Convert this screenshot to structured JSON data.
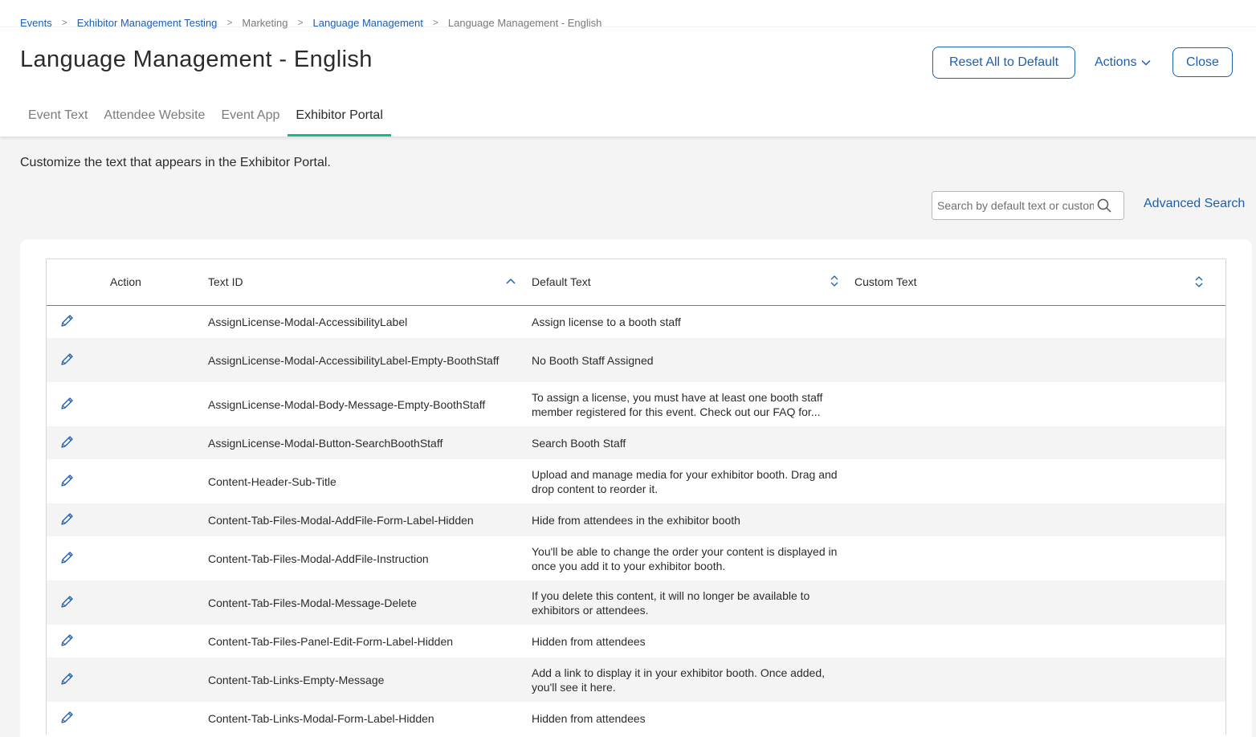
{
  "breadcrumb": [
    {
      "label": "Events",
      "link": true
    },
    {
      "label": "Exhibitor Management Testing",
      "link": true
    },
    {
      "label": "Marketing",
      "link": false
    },
    {
      "label": "Language Management",
      "link": true
    },
    {
      "label": "Language Management - English",
      "link": false
    }
  ],
  "page": {
    "title": "Language Management - English"
  },
  "buttons": {
    "reset": "Reset All to Default",
    "actions": "Actions",
    "close": "Close"
  },
  "tabs": [
    {
      "label": "Event Text",
      "active": false
    },
    {
      "label": "Attendee Website",
      "active": false
    },
    {
      "label": "Event App",
      "active": false
    },
    {
      "label": "Exhibitor Portal",
      "active": true
    }
  ],
  "description": "Customize the text that appears in the Exhibitor Portal.",
  "search": {
    "placeholder": "Search by default text or custom text",
    "advanced": "Advanced Search"
  },
  "table": {
    "columns": {
      "action": "Action",
      "text_id": "Text ID",
      "default_text": "Default Text",
      "custom_text": "Custom Text"
    },
    "rows": [
      {
        "text_id": "AssignLicense-Modal-AccessibilityLabel",
        "default_text": "Assign license to a booth staff",
        "custom_text": ""
      },
      {
        "text_id": "AssignLicense-Modal-AccessibilityLabel-Empty-BoothStaff",
        "default_text": "No Booth Staff Assigned",
        "custom_text": ""
      },
      {
        "text_id": "AssignLicense-Modal-Body-Message-Empty-BoothStaff",
        "default_text": "To assign a license, you must have at least one booth staff member registered for this event. Check out our FAQ for...",
        "custom_text": ""
      },
      {
        "text_id": "AssignLicense-Modal-Button-SearchBoothStaff",
        "default_text": "Search Booth Staff",
        "custom_text": ""
      },
      {
        "text_id": "Content-Header-Sub-Title",
        "default_text": "Upload and manage media for your exhibitor booth. Drag and drop content to reorder it.",
        "custom_text": ""
      },
      {
        "text_id": "Content-Tab-Files-Modal-AddFile-Form-Label-Hidden",
        "default_text": "Hide from attendees in the exhibitor booth",
        "custom_text": ""
      },
      {
        "text_id": "Content-Tab-Files-Modal-AddFile-Instruction",
        "default_text": "You'll be able to change the order your content is displayed in once you add it to your exhibitor booth.",
        "custom_text": ""
      },
      {
        "text_id": "Content-Tab-Files-Modal-Message-Delete",
        "default_text": "If you delete this content, it will no longer be available to exhibitors or attendees.",
        "custom_text": ""
      },
      {
        "text_id": "Content-Tab-Files-Panel-Edit-Form-Label-Hidden",
        "default_text": "Hidden from attendees",
        "custom_text": ""
      },
      {
        "text_id": "Content-Tab-Links-Empty-Message",
        "default_text": "Add a link to display it in your exhibitor booth. Once added, you'll see it here.",
        "custom_text": ""
      },
      {
        "text_id": "Content-Tab-Links-Modal-Form-Label-Hidden",
        "default_text": "Hidden from attendees",
        "custom_text": ""
      }
    ]
  },
  "icons": {
    "edit": "pencil-icon",
    "search": "search-icon",
    "sort": "sort-icon",
    "chevron": "chevron-down-icon"
  },
  "colors": {
    "link": "#1a5fb4",
    "tab_active_underline": "#17b893",
    "row_alt": "#f4f4f4",
    "page_bg": "#f4f4f4"
  }
}
